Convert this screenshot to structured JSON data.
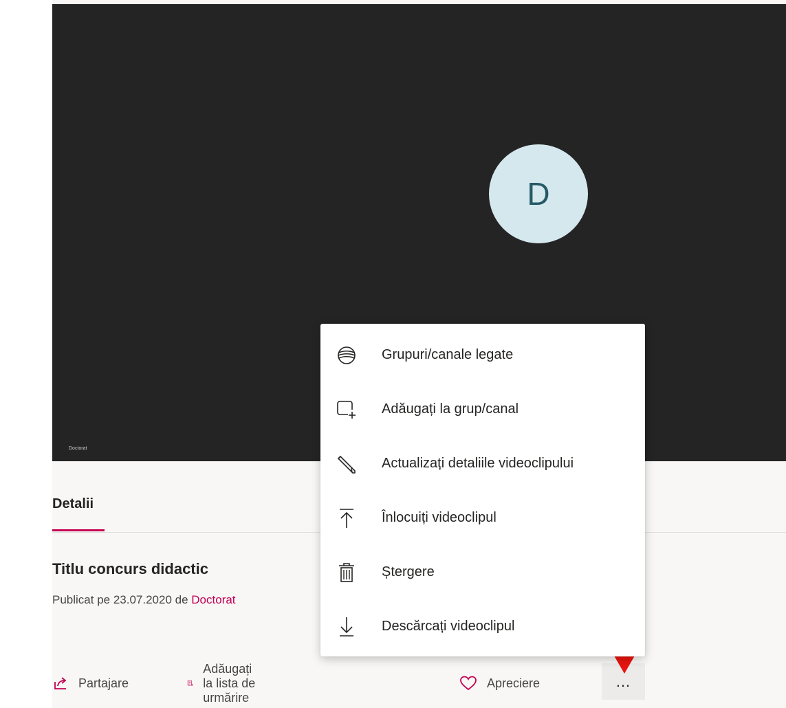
{
  "video": {
    "avatar_letter": "D",
    "caption": "Doctorat"
  },
  "tabs": [
    {
      "label": "Detalii"
    }
  ],
  "details": {
    "title": "Titlu concurs didactic",
    "published_prefix": "Publicat pe 23.07.2020 de ",
    "author": "Doctorat"
  },
  "actions": {
    "share_label": "Partajare",
    "watchlist_label": "Adăugați la lista de urmărire",
    "like_label": "Apreciere",
    "more_label": "..."
  },
  "menu": {
    "items": [
      {
        "label": "Grupuri/canale legate",
        "icon": "linked-groups-icon"
      },
      {
        "label": "Adăugați la grup/canal",
        "icon": "add-to-group-icon"
      },
      {
        "label": "Actualizați detaliile videoclipului",
        "icon": "pencil-icon"
      },
      {
        "label": "Înlocuiți videoclipul",
        "icon": "upload-icon"
      },
      {
        "label": "Ștergere",
        "icon": "trash-icon"
      },
      {
        "label": "Descărcați videoclipul",
        "icon": "download-icon"
      }
    ]
  },
  "colors": {
    "accent": "#c30052",
    "video_bg": "#252424",
    "avatar_bg": "#d5e8ee",
    "avatar_text": "#255a66",
    "annotation_arrow": "#e8140e"
  }
}
